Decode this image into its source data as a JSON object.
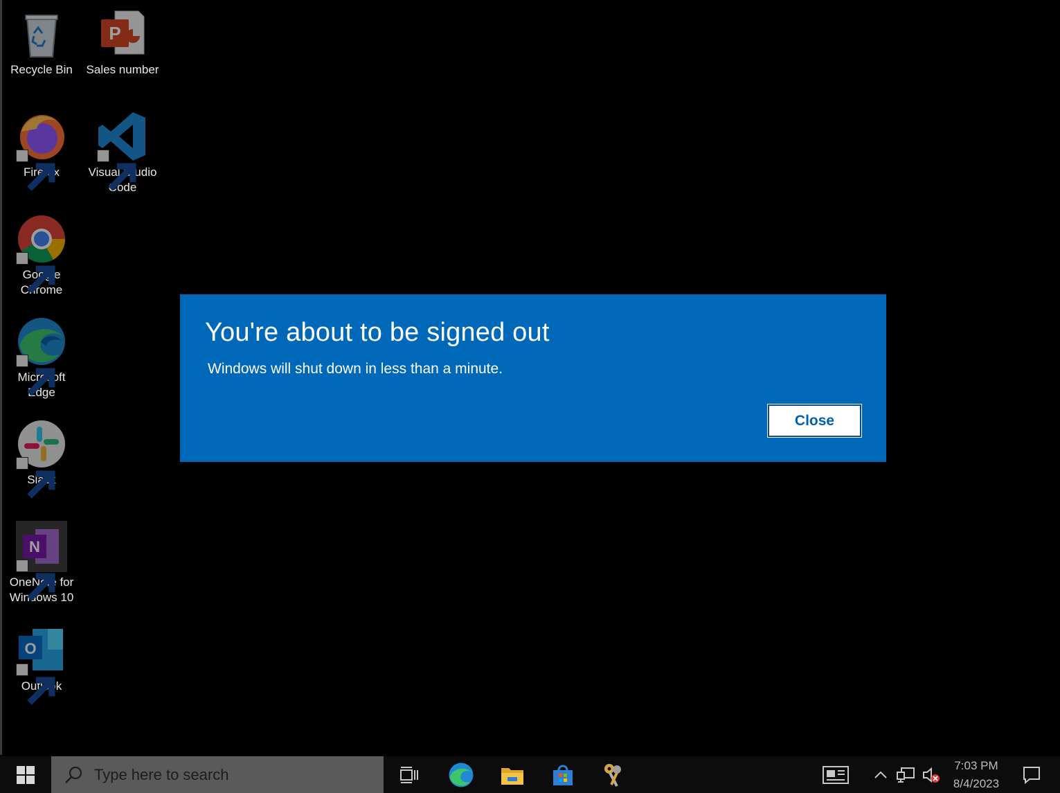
{
  "desktop": {
    "icons": [
      {
        "label": "Recycle Bin",
        "icon": "recycle-bin-icon"
      },
      {
        "label": "Sales number",
        "icon": "powerpoint-file-icon"
      },
      {
        "label": "Firefox",
        "icon": "firefox-icon"
      },
      {
        "label": "Visual Studio Code",
        "icon": "vscode-icon"
      },
      {
        "label": "Google Chrome",
        "icon": "chrome-icon"
      },
      {
        "label": "Microsoft Edge",
        "icon": "edge-icon"
      },
      {
        "label": "Slack",
        "icon": "slack-icon"
      },
      {
        "label": "OneNote for Windows 10",
        "icon": "onenote-icon"
      },
      {
        "label": "Outlook",
        "icon": "outlook-icon"
      }
    ]
  },
  "dialog": {
    "title": "You're about to be signed out",
    "message": "Windows will shut down in less than a minute.",
    "close_label": "Close",
    "background": "#0068b8"
  },
  "taskbar": {
    "search_placeholder": "Type here to search",
    "pinned": [
      "task-view-icon",
      "edge-icon",
      "file-explorer-icon",
      "microsoft-store-icon",
      "keys-app-icon"
    ],
    "tray": [
      "news-widget-icon",
      "show-hidden-icons-chevron",
      "network-icon",
      "volume-muted-icon"
    ],
    "time": "7:03 PM",
    "date": "8/4/2023"
  }
}
